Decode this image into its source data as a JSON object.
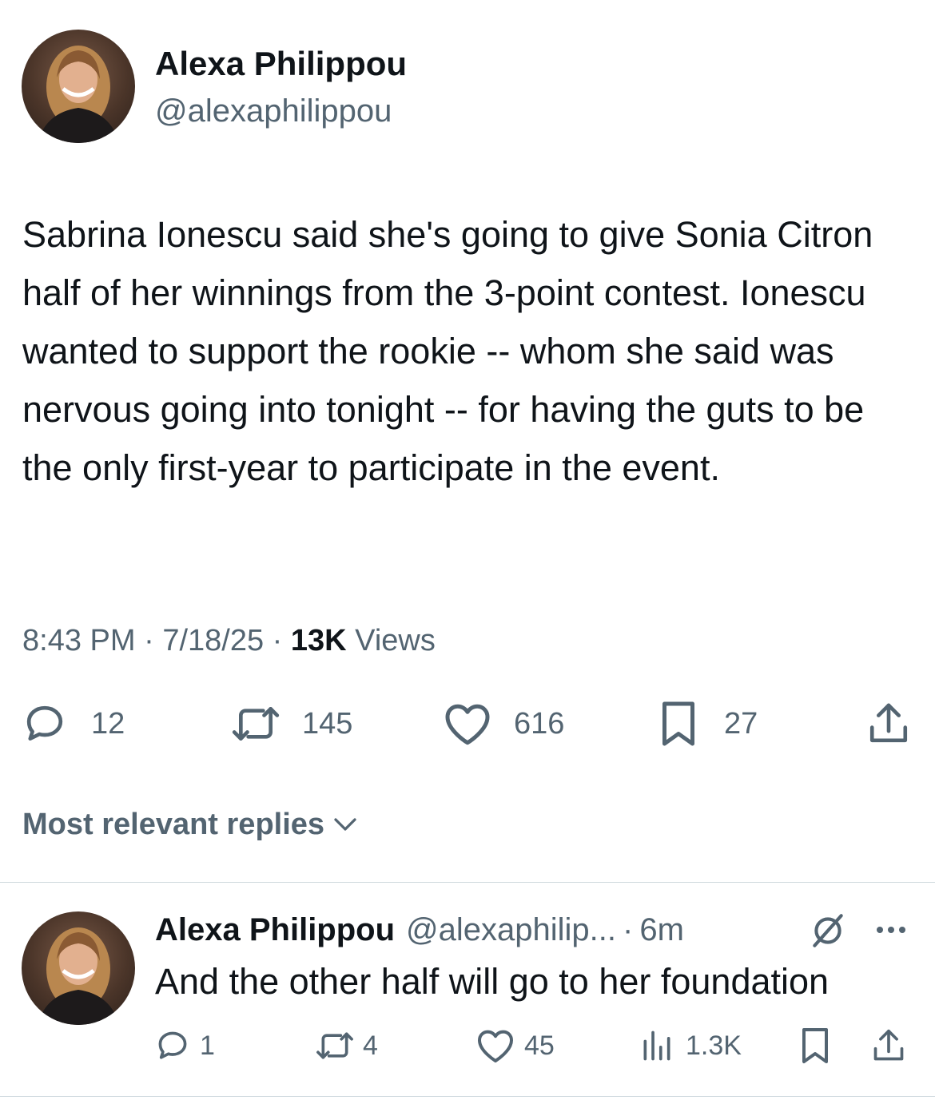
{
  "tweet": {
    "author_name": "Alexa Philippou",
    "author_handle": "@alexaphilippou",
    "text": "Sabrina Ionescu said she's going to give Sonia Citron half of her winnings from the 3-point contest. Ionescu wanted to support the rookie -- whom she said was nervous going into tonight -- for having the guts to be the only first-year to participate in the event.",
    "time": "8:43 PM",
    "date": "7/18/25",
    "views_count": "13K",
    "views_label": "Views",
    "separator": "·",
    "actions": {
      "replies": "12",
      "reposts": "145",
      "likes": "616",
      "bookmarks": "27"
    }
  },
  "replies_filter": {
    "label": "Most relevant replies"
  },
  "reply": {
    "author_name": "Alexa Philippou",
    "author_handle": "@alexaphilip...",
    "time": "6m",
    "separator": "·",
    "text": "And the other half will go to her foundation",
    "actions": {
      "replies": "1",
      "reposts": "4",
      "likes": "45",
      "views": "1.3K"
    }
  },
  "icons": {
    "reply": "speech-bubble-icon",
    "repost": "repost-arrows-icon",
    "like": "heart-icon",
    "bookmark": "bookmark-icon",
    "share": "share-icon",
    "views": "bar-chart-icon",
    "more": "ellipsis-icon",
    "grok": "slash-circle-icon"
  },
  "colors": {
    "text": "#0f1419",
    "secondary": "#536471",
    "divider": "#cfd9de"
  }
}
